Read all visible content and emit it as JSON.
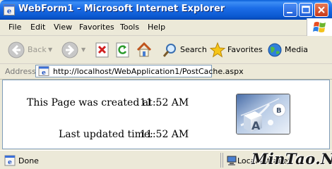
{
  "window": {
    "title": "WebForm1 - Microsoft Internet Explorer"
  },
  "menu": {
    "items": [
      "File",
      "Edit",
      "View",
      "Favorites",
      "Tools",
      "Help"
    ]
  },
  "toolbar": {
    "back_label": "Back",
    "search_label": "Search",
    "favorites_label": "Favorites",
    "media_label": "Media",
    "icons": [
      "back-arrow-icon",
      "forward-arrow-icon",
      "stop-icon",
      "refresh-icon",
      "home-icon",
      "search-icon",
      "favorites-star-icon",
      "media-globe-icon"
    ]
  },
  "address": {
    "label": "Address",
    "url": "http://localhost/WebApplication1/PostCache.aspx"
  },
  "page": {
    "created_label": "This Page was created at :",
    "created_time": "11:52 AM",
    "updated_label": "Last updated time:",
    "updated_time": "11:52 AM",
    "image_letters": [
      "A",
      "B"
    ]
  },
  "status": {
    "text": "Done",
    "zone": "Local intranet",
    "watermark": "MinTao.Net"
  }
}
